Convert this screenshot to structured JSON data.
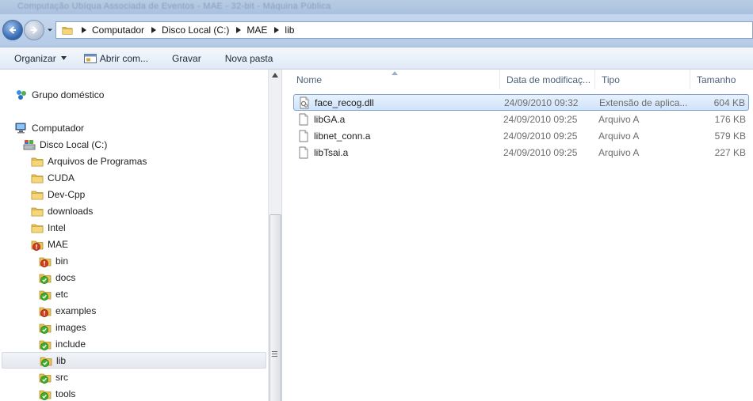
{
  "window": {
    "title": "Computação Ubíqua Associada de Eventos - MAE - 32-bit - Máquina Pública"
  },
  "address_bar": {
    "breadcrumbs": [
      "Computador",
      "Disco Local (C:)",
      "MAE",
      "lib"
    ]
  },
  "toolbar": {
    "organize_label": "Organizar",
    "open_with_label": "Abrir com...",
    "burn_label": "Gravar",
    "new_folder_label": "Nova pasta"
  },
  "nav_tree": {
    "homegroup": "Grupo doméstico",
    "computer": "Computador",
    "local_disk": "Disco Local (C:)",
    "folders": [
      {
        "label": "Arquivos de Programas",
        "icon": "folder-icon"
      },
      {
        "label": "CUDA",
        "icon": "folder-icon"
      },
      {
        "label": "Dev-Cpp",
        "icon": "folder-icon"
      },
      {
        "label": "downloads",
        "icon": "folder-icon"
      },
      {
        "label": "Intel",
        "icon": "folder-icon"
      },
      {
        "label": "MAE",
        "icon": "svn-conflict-folder-icon"
      }
    ],
    "subfolders": [
      {
        "label": "bin",
        "icon": "svn-conflict-folder-icon"
      },
      {
        "label": "docs",
        "icon": "svn-ok-folder-icon"
      },
      {
        "label": "etc",
        "icon": "svn-ok-folder-icon"
      },
      {
        "label": "examples",
        "icon": "svn-conflict-folder-icon"
      },
      {
        "label": "images",
        "icon": "svn-ok-folder-icon"
      },
      {
        "label": "include",
        "icon": "svn-ok-folder-icon"
      },
      {
        "label": "lib",
        "icon": "svn-ok-folder-icon",
        "selected": true
      },
      {
        "label": "src",
        "icon": "svn-ok-folder-icon"
      },
      {
        "label": "tools",
        "icon": "svn-ok-folder-icon"
      }
    ]
  },
  "file_list": {
    "columns": {
      "name": "Nome",
      "date": "Data de modificaç...",
      "type": "Tipo",
      "size": "Tamanho"
    },
    "rows": [
      {
        "name": "face_recog.dll",
        "date": "24/09/2010 09:32",
        "type": "Extensão de aplica...",
        "size": "604 KB",
        "icon": "dll-file-icon",
        "selected": true
      },
      {
        "name": "libGA.a",
        "date": "24/09/2010 09:25",
        "type": "Arquivo A",
        "size": "176 KB",
        "icon": "file-icon"
      },
      {
        "name": "libnet_conn.a",
        "date": "24/09/2010 09:25",
        "type": "Arquivo A",
        "size": "579 KB",
        "icon": "file-icon"
      },
      {
        "name": "libTsai.a",
        "date": "24/09/2010 09:25",
        "type": "Arquivo A",
        "size": "227 KB",
        "icon": "file-icon"
      }
    ]
  },
  "colors": {
    "selection_border": "#7da2ce",
    "svn_ok": "#3fae2a",
    "svn_conflict": "#d23a1e",
    "folder": "#e9c15a"
  }
}
